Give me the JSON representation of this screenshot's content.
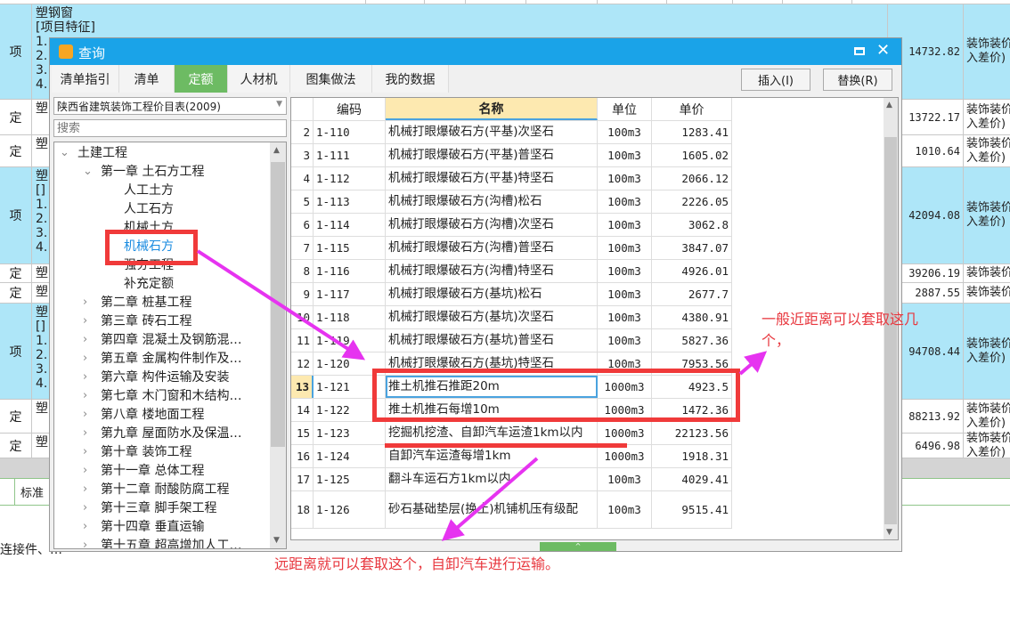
{
  "background": {
    "rows": [
      {
        "type": "项",
        "name": "塑钢窗\n[项目特征]\n1.\n2.\n3.\n4.",
        "value": "14732.82",
        "desc": "装饰装价\n入差价)",
        "blue": true
      },
      {
        "type": "定",
        "name": "塑",
        "value": "13722.17",
        "desc": "装饰装价\n入差价)",
        "blue": false
      },
      {
        "type": "定",
        "name": "塑",
        "value": "1010.64",
        "desc": "装饰装价\n入差价)",
        "blue": false
      },
      {
        "type": "项",
        "name": "塑\n[]\n1.\n2.\n3.\n4.",
        "value": "42094.08",
        "desc": "装饰装价\n入差价)",
        "blue": true
      },
      {
        "type": "定",
        "name": "塑",
        "value": "39206.19",
        "desc": "装饰装价",
        "blue": false
      },
      {
        "type": "定",
        "name": "塑",
        "value": "2887.55",
        "desc": "装饰装价",
        "blue": false
      },
      {
        "type": "项",
        "name": "塑\n[]\n1.\n2.\n3.\n4.",
        "value": "94708.44",
        "desc": "装饰装价\n入差价)",
        "blue": true
      },
      {
        "type": "定",
        "name": "塑",
        "value": "88213.92",
        "desc": "装饰装价\n入差价)",
        "blue": false
      },
      {
        "type": "定",
        "name": "塑",
        "value": "6496.98",
        "desc": "装饰装价\n入差价)",
        "blue": false
      }
    ],
    "bottom_tab": "标准",
    "bottom_text": "连接件、…"
  },
  "dialog": {
    "title": "查询",
    "tabs": [
      "清单指引",
      "清单",
      "定额",
      "人材机",
      "图集做法",
      "我的数据"
    ],
    "active_tab": "定额",
    "insert_button": "插入(I)",
    "replace_button": "替换(R)",
    "library_select": "陕西省建筑装饰工程价目表(2009)",
    "search_placeholder": "搜索",
    "tree": [
      {
        "label": "土建工程",
        "level": 0,
        "expanded": true
      },
      {
        "label": "第一章  土石方工程",
        "level": 1,
        "expanded": true
      },
      {
        "label": "人工土方",
        "level": 2
      },
      {
        "label": "人工石方",
        "level": 2
      },
      {
        "label": "机械土方",
        "level": 2
      },
      {
        "label": "机械石方",
        "level": 2,
        "selected": true
      },
      {
        "label": "强夯工程",
        "level": 2
      },
      {
        "label": "补充定额",
        "level": 2
      },
      {
        "label": "第二章  桩基工程",
        "level": 1
      },
      {
        "label": "第三章  砖石工程",
        "level": 1
      },
      {
        "label": "第四章  混凝土及钢筋混…",
        "level": 1
      },
      {
        "label": "第五章  金属构件制作及…",
        "level": 1
      },
      {
        "label": "第六章  构件运输及安装",
        "level": 1
      },
      {
        "label": "第七章  木门窗和木结构…",
        "level": 1
      },
      {
        "label": "第八章  楼地面工程",
        "level": 1
      },
      {
        "label": "第九章  屋面防水及保温…",
        "level": 1
      },
      {
        "label": "第十章  装饰工程",
        "level": 1
      },
      {
        "label": "第十一章  总体工程",
        "level": 1
      },
      {
        "label": "第十二章  耐酸防腐工程",
        "level": 1
      },
      {
        "label": "第十三章  脚手架工程",
        "level": 1
      },
      {
        "label": "第十四章  垂直运输",
        "level": 1
      },
      {
        "label": "第十五章  超高增加人工…",
        "level": 1
      }
    ],
    "grid": {
      "headers": [
        "编码",
        "名称",
        "单位",
        "单价"
      ],
      "rows": [
        {
          "n": "2",
          "code": "1-110",
          "name": "机械打眼爆破石方(平基)次坚石",
          "unit": "100m3",
          "price": "1283.41"
        },
        {
          "n": "3",
          "code": "1-111",
          "name": "机械打眼爆破石方(平基)普坚石",
          "unit": "100m3",
          "price": "1605.02"
        },
        {
          "n": "4",
          "code": "1-112",
          "name": "机械打眼爆破石方(平基)特坚石",
          "unit": "100m3",
          "price": "2066.12"
        },
        {
          "n": "5",
          "code": "1-113",
          "name": "机械打眼爆破石方(沟槽)松石",
          "unit": "100m3",
          "price": "2226.05"
        },
        {
          "n": "6",
          "code": "1-114",
          "name": "机械打眼爆破石方(沟槽)次坚石",
          "unit": "100m3",
          "price": "3062.8"
        },
        {
          "n": "7",
          "code": "1-115",
          "name": "机械打眼爆破石方(沟槽)普坚石",
          "unit": "100m3",
          "price": "3847.07"
        },
        {
          "n": "8",
          "code": "1-116",
          "name": "机械打眼爆破石方(沟槽)特坚石",
          "unit": "100m3",
          "price": "4926.01"
        },
        {
          "n": "9",
          "code": "1-117",
          "name": "机械打眼爆破石方(基坑)松石",
          "unit": "100m3",
          "price": "2677.7"
        },
        {
          "n": "10",
          "code": "1-118",
          "name": "机械打眼爆破石方(基坑)次坚石",
          "unit": "100m3",
          "price": "4380.91"
        },
        {
          "n": "11",
          "code": "1-119",
          "name": "机械打眼爆破石方(基坑)普坚石",
          "unit": "100m3",
          "price": "5827.36"
        },
        {
          "n": "12",
          "code": "1-120",
          "name": "机械打眼爆破石方(基坑)特坚石",
          "unit": "100m3",
          "price": "7953.56"
        },
        {
          "n": "13",
          "code": "1-121",
          "name": "推土机推石推距20m",
          "unit": "1000m3",
          "price": "4923.5",
          "selected": true
        },
        {
          "n": "14",
          "code": "1-122",
          "name": "推土机推石每增10m",
          "unit": "1000m3",
          "price": "1472.36"
        },
        {
          "n": "15",
          "code": "1-123",
          "name": "挖掘机挖渣、自卸汽车运渣1km以内",
          "unit": "1000m3",
          "price": "22123.56"
        },
        {
          "n": "16",
          "code": "1-124",
          "name": "自卸汽车运渣每增1km",
          "unit": "1000m3",
          "price": "1918.31"
        },
        {
          "n": "17",
          "code": "1-125",
          "name": "翻斗车运石方1km以内",
          "unit": "100m3",
          "price": "4029.41"
        },
        {
          "n": "18",
          "code": "1-126",
          "name": "砂石基础垫层(换土)机铺机压有级配",
          "unit": "100m3",
          "price": "9515.41"
        }
      ]
    }
  },
  "annotations": {
    "near": "一般近距离可以套取这几个，",
    "far": "远距离就可以套取这个，自卸汽车进行运输。"
  },
  "colors": {
    "title_bar": "#1aa3e8",
    "active_tab": "#6dbb63",
    "annotation": "#e8383f",
    "arrow": "#e633f0",
    "highlight_row": "#aee6f8"
  }
}
